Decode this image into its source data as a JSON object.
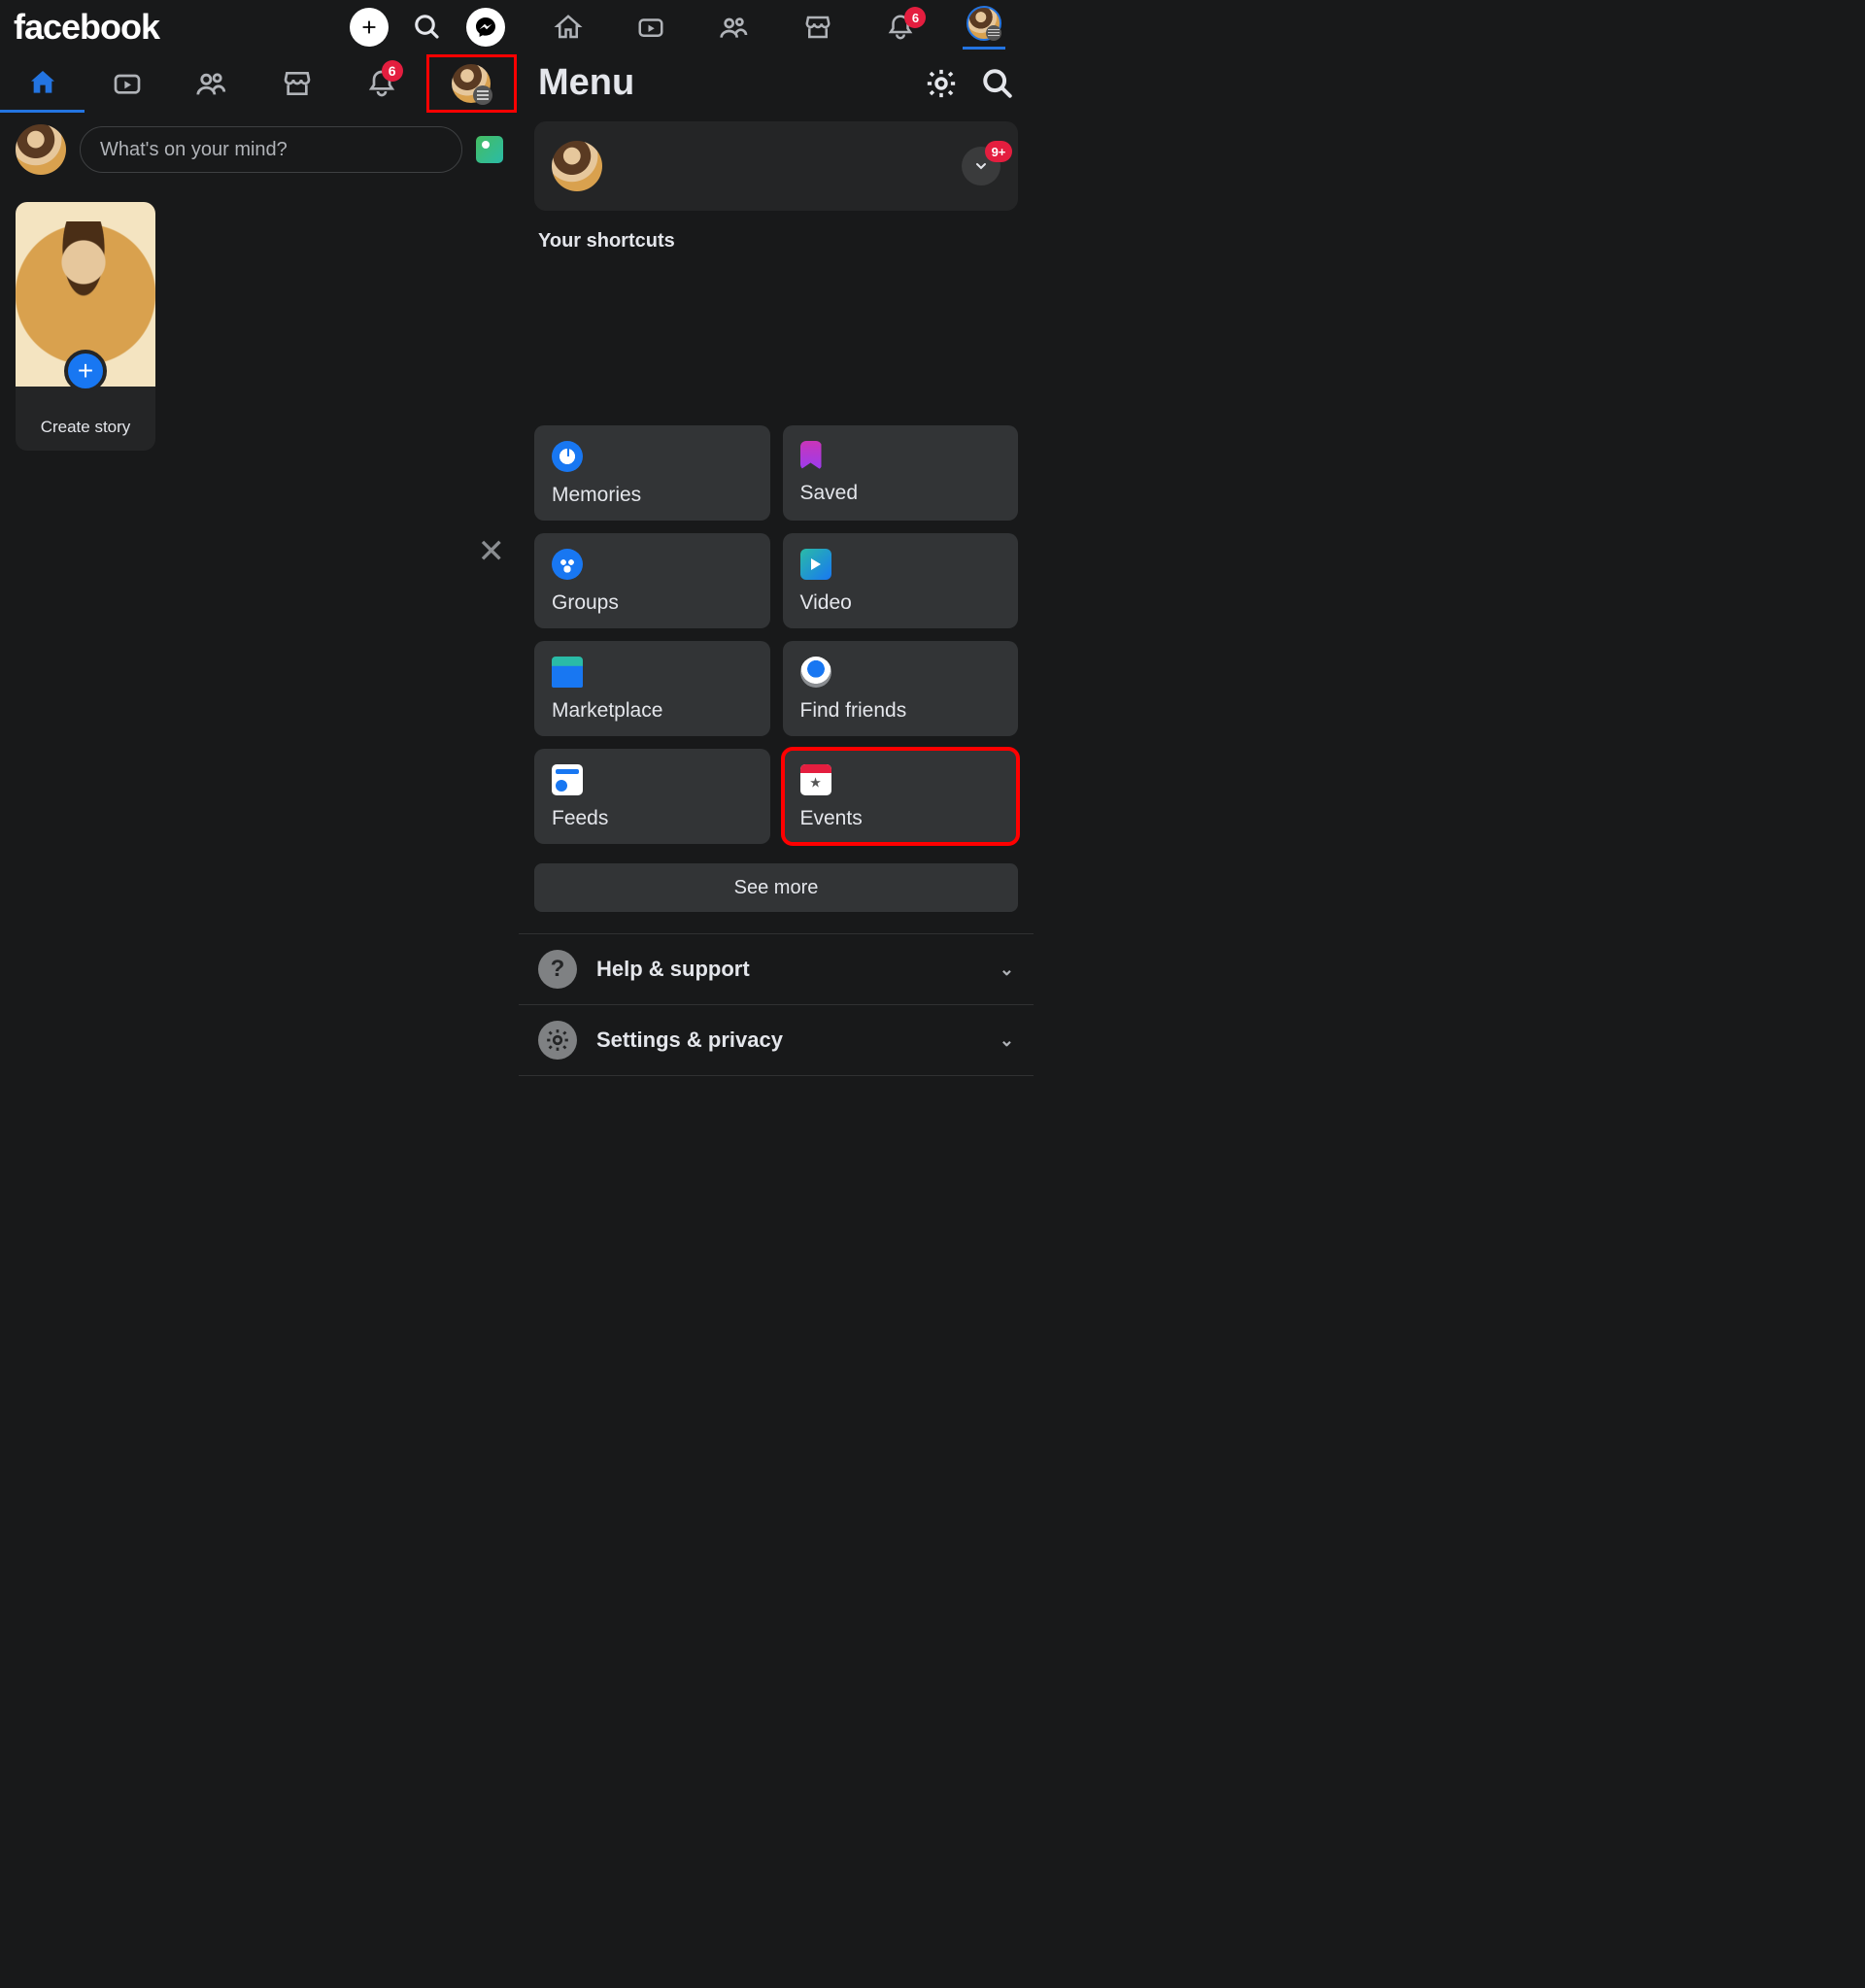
{
  "left": {
    "logo": "facebook",
    "tabs": {
      "home": "home",
      "video": "video",
      "friends": "friends",
      "market": "marketplace",
      "notif": "notifications",
      "notif_badge": "6",
      "menu": "profile-menu"
    },
    "composer": {
      "placeholder": "What's on your mind?"
    },
    "story": {
      "create_label": "Create story"
    }
  },
  "right": {
    "topbar": {
      "notif_badge": "6"
    },
    "menu_title": "Menu",
    "profile_expand_badge": "9+",
    "shortcuts_label": "Your shortcuts",
    "tiles": {
      "memories": "Memories",
      "saved": "Saved",
      "groups": "Groups",
      "video": "Video",
      "marketplace": "Marketplace",
      "find_friends": "Find friends",
      "feeds": "Feeds",
      "events": "Events"
    },
    "see_more": "See more",
    "accordion": {
      "help": "Help & support",
      "settings": "Settings & privacy"
    }
  }
}
